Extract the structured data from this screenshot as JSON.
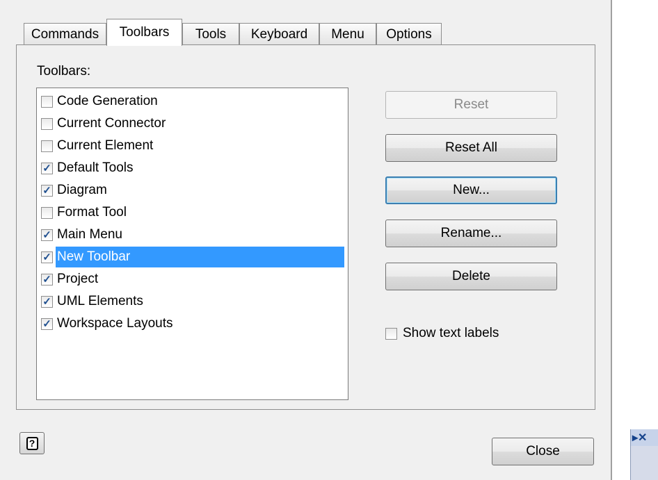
{
  "tabs": [
    {
      "label": "Commands",
      "active": false
    },
    {
      "label": "Toolbars",
      "active": true
    },
    {
      "label": "Tools",
      "active": false
    },
    {
      "label": "Keyboard",
      "active": false
    },
    {
      "label": "Menu",
      "active": false
    },
    {
      "label": "Options",
      "active": false
    }
  ],
  "list_label": "Toolbars:",
  "toolbars": [
    {
      "label": "Code Generation",
      "checked": false
    },
    {
      "label": "Current Connector",
      "checked": false
    },
    {
      "label": "Current Element",
      "checked": false
    },
    {
      "label": "Default Tools",
      "checked": true
    },
    {
      "label": "Diagram",
      "checked": true
    },
    {
      "label": "Format Tool",
      "checked": false
    },
    {
      "label": "Main Menu",
      "checked": true
    },
    {
      "label": "New Toolbar",
      "checked": true,
      "selected": true
    },
    {
      "label": "Project",
      "checked": true
    },
    {
      "label": "UML Elements",
      "checked": true
    },
    {
      "label": "Workspace Layouts",
      "checked": true
    }
  ],
  "buttons": {
    "reset": "Reset",
    "reset_all": "Reset All",
    "new": "New...",
    "rename": "Rename...",
    "delete": "Delete",
    "close": "Close"
  },
  "show_text_labels": {
    "label": "Show text labels",
    "checked": false
  },
  "help_glyph": "?",
  "ghost_window_glyph": "▸✕",
  "colors": {
    "selection": "#3399ff",
    "dialog_bg": "#f0f0f0"
  }
}
